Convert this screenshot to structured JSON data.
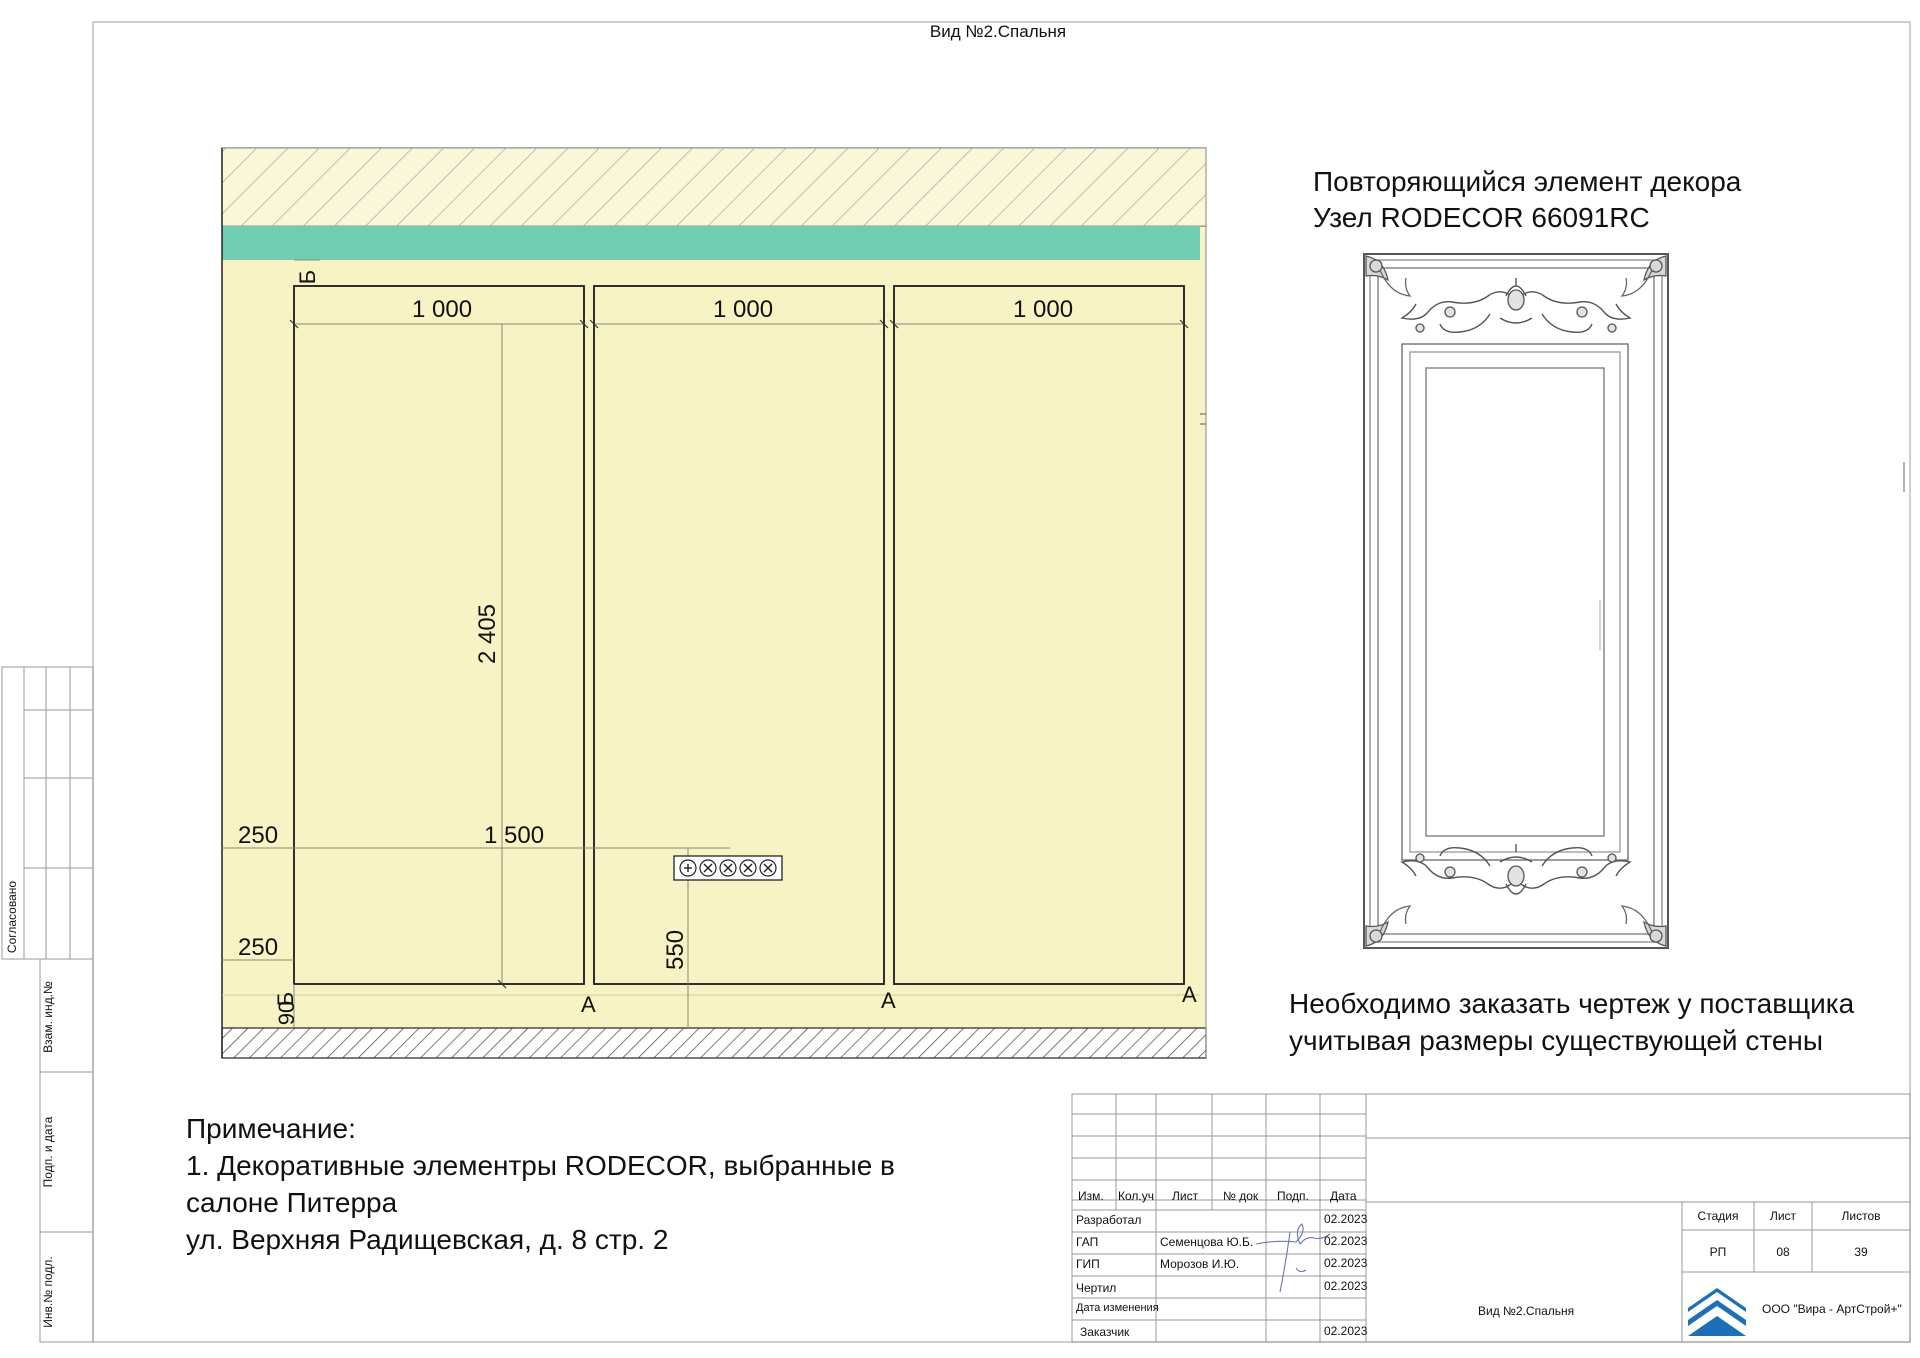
{
  "sheet": {
    "title": "Вид №2.Спальня"
  },
  "elevation": {
    "dims": {
      "panel_width_1": "1 000",
      "panel_width_2": "1 000",
      "panel_width_3": "1 000",
      "panel_height": "2 405",
      "h_1500": "1 500",
      "offset_250_top": "250",
      "offset_250_bottom": "250",
      "socket_height": "550",
      "plinth_90": "90"
    },
    "markers": {
      "b_top": "Б",
      "b_bottom": "Б",
      "a_1": "А",
      "a_2": "А",
      "a_3": "А"
    },
    "colors": {
      "wall": "#f8f3c4",
      "molding_band": "#72ccb0",
      "hatch": "#9a9a9a"
    }
  },
  "decor": {
    "line1": "Повторяющийся элемент декора",
    "line2": "Узел RODECOR 66091RC",
    "order_note_1": "Необходимо заказать чертеж у поставщика",
    "order_note_2": "учитывая размеры существующей стены"
  },
  "note": {
    "heading": "Примечание:",
    "line1": "1. Декоративные элементры RODECOR, выбранные в",
    "line2": "салоне Питерра",
    "line3": "ул. Верхняя Радищевская, д. 8 стр. 2"
  },
  "side_stamp": {
    "soglasovano": "Согласовано",
    "vzam": "Взам. инд.№",
    "podp_data": "Подп. и дата",
    "inv": "Инв.№ подл."
  },
  "title_block": {
    "headers": [
      "Изм.",
      "Кол.уч",
      "Лист",
      "№ док",
      "Подп.",
      "Дата"
    ],
    "rows": [
      {
        "role": "Разработал",
        "name": "",
        "date": "02.2023"
      },
      {
        "role": "ГАП",
        "name": "Семенцова Ю.Б.",
        "date": "02.2023"
      },
      {
        "role": "ГИП",
        "name": "Морозов И.Ю.",
        "date": "02.2023"
      },
      {
        "role": "Чертил",
        "name": "",
        "date": "02.2023"
      },
      {
        "role": "Дата изменения",
        "name": "",
        "date": ""
      },
      {
        "role": "Заказчик",
        "name": "",
        "date": "02.2023"
      }
    ],
    "stage_label": "Стадия",
    "sheet_label": "Лист",
    "sheets_label": "Листов",
    "stage": "РП",
    "sheet": "08",
    "sheets": "39",
    "view_name": "Вид №2.Спальня",
    "company": "ООО \"Вира - АртСтрой+\"",
    "logo_color": "#1f6fb8"
  }
}
